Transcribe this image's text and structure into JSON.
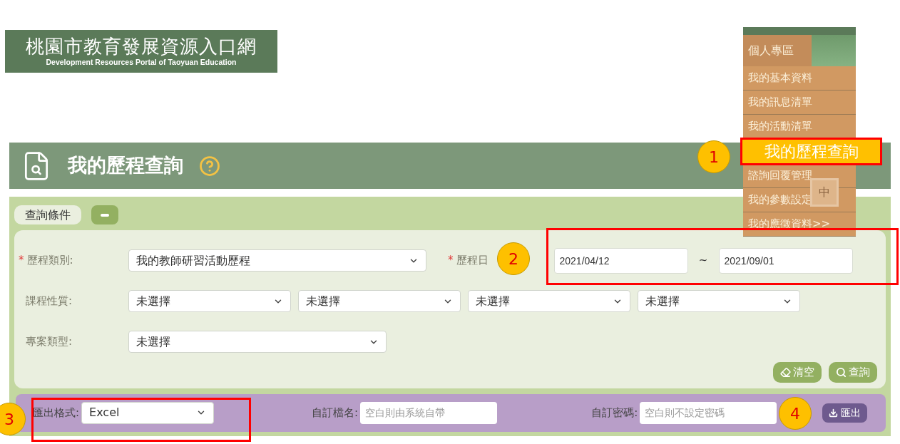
{
  "logo": {
    "title": "桃園市教育發展資源入口網",
    "subtitle": "Development Resources Portal of Taoyuan Education"
  },
  "user_menu": {
    "heading": "個人專區",
    "items": [
      {
        "label": "我的基本資料",
        "selected": false
      },
      {
        "label": "我的訊息清單",
        "selected": false
      },
      {
        "label": "我的活動清單",
        "selected": false
      },
      {
        "label": "我的歷程查詢",
        "selected": true
      },
      {
        "label": "諮詢回覆管理",
        "selected": false
      },
      {
        "label": "我的參數設定",
        "selected": false
      },
      {
        "label": "我的應徵資料>>",
        "selected": false
      }
    ]
  },
  "language_button": "中",
  "page_title": "我的歷程查詢",
  "panel": {
    "section_tab": "查詢條件",
    "rows": [
      {
        "required_mark": "*",
        "label": "歷程類別:",
        "selects": [
          "我的教師研習活動歷程"
        ]
      },
      {
        "label": "課程性質:",
        "selects": [
          "未選擇",
          "未選擇",
          "未選擇",
          "未選擇"
        ]
      },
      {
        "label": "專案類型:",
        "selects": [
          "未選擇"
        ]
      }
    ],
    "date_range": {
      "required_mark": "*",
      "label": "歷程日",
      "start": "2021/04/12",
      "separator": "~",
      "end": "2021/09/01"
    },
    "buttons": [
      {
        "kind": "clear",
        "label": "清空"
      },
      {
        "kind": "search",
        "label": "查詢"
      }
    ],
    "export": {
      "format_label": "匯出格式:",
      "format": "Excel",
      "filename_label": "自訂檔名:",
      "filename_placeholder": "空白則由系統自帶",
      "password_label": "自訂密碼:",
      "password_placeholder": "空白則不設定密碼",
      "button": "匯出"
    }
  },
  "callouts": [
    "1",
    "2",
    "3",
    "4"
  ]
}
